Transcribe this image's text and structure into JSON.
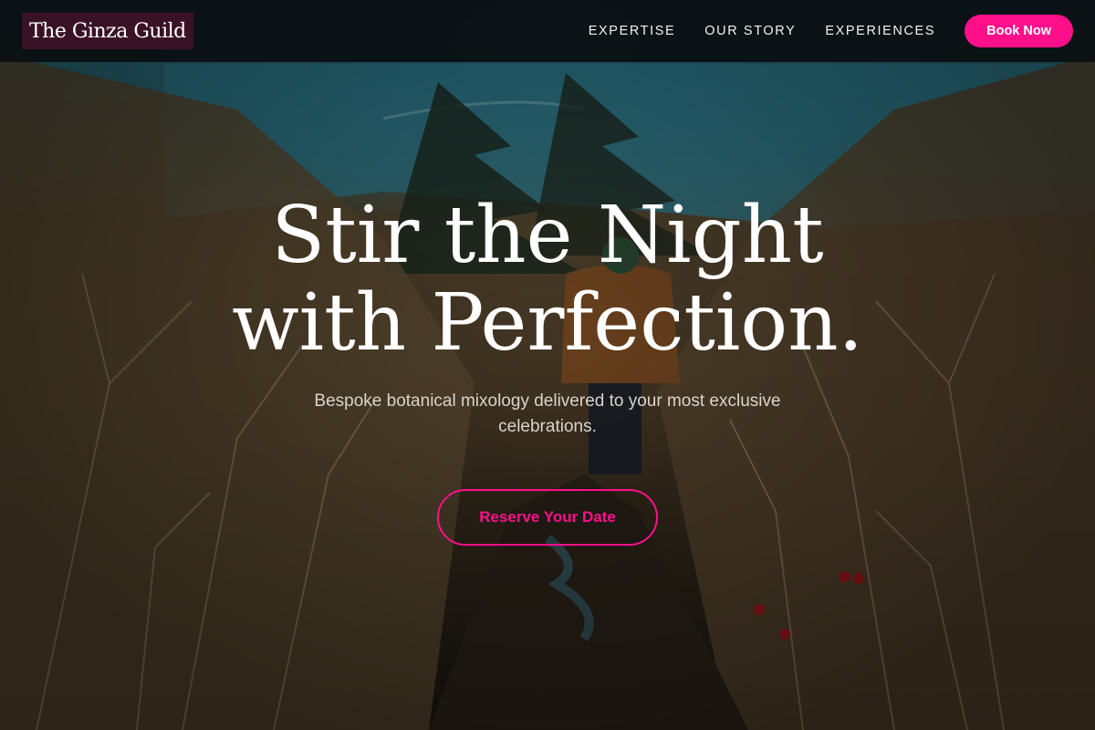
{
  "brand": {
    "name": "The Ginza Guild"
  },
  "nav": {
    "items": [
      {
        "label": "EXPERTISE"
      },
      {
        "label": "OUR STORY"
      },
      {
        "label": "EXPERIENCES"
      }
    ],
    "cta_label": "Book Now"
  },
  "hero": {
    "headline_line1": "Stir the Night",
    "headline_line2": "with Perfection.",
    "subheadline": "Bespoke botanical mixology delivered to your most exclusive celebrations.",
    "cta_label": "Reserve Your Date"
  },
  "colors": {
    "accent": "#ff0f8a",
    "header_bg": "#0a0e10",
    "logo_bg": "#3a1226"
  }
}
